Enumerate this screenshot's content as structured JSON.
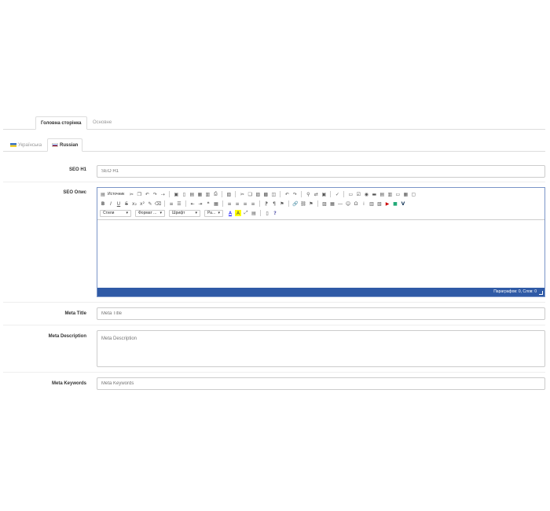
{
  "top_tabs": [
    {
      "label": "Головна сторінка",
      "active": true
    },
    {
      "label": "Основне",
      "active": false
    }
  ],
  "lang_tabs": [
    {
      "label": "Українська",
      "flag": "ua-flag",
      "active": false
    },
    {
      "label": "Russian",
      "flag": "ru-flag",
      "active": true
    }
  ],
  "fields": {
    "seo_h1": {
      "label": "SEO H1",
      "placeholder": "SEO H1",
      "value": ""
    },
    "seo_description": {
      "label": "SEO Опис"
    },
    "meta_title": {
      "label": "Meta Title",
      "placeholder": "Meta Title",
      "value": ""
    },
    "meta_description": {
      "label": "Meta Description",
      "placeholder": "Meta Description",
      "value": ""
    },
    "meta_keywords": {
      "label": "Meta Keywords",
      "placeholder": "Meta Keywords",
      "value": ""
    }
  },
  "editor": {
    "source_label": "Источник",
    "combos": {
      "styles": "Стили",
      "format": "Формат ...",
      "font": "Шрифт",
      "size": "Ра..."
    },
    "status": "Параграфов: 0, Слов: 0"
  },
  "colors": {
    "accent": "#2f5aa6",
    "border": "#cccccc"
  }
}
